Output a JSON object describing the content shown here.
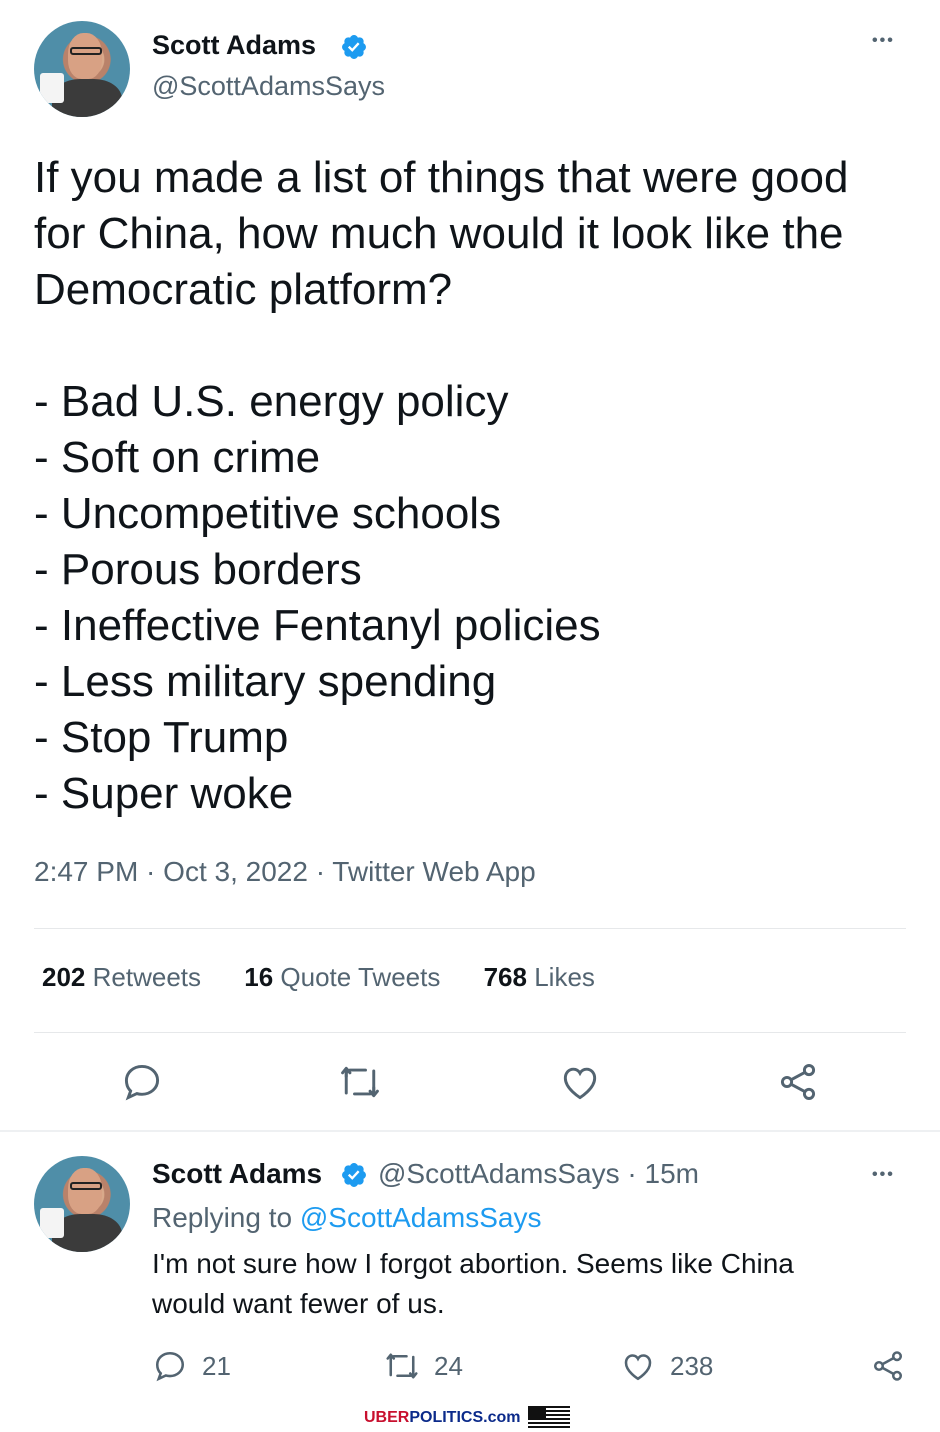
{
  "main_tweet": {
    "author_name": "Scott Adams",
    "author_handle": "@ScottAdamsSays",
    "more_label": "•••",
    "text_lines": [
      "If you made a list of things that were good",
      "for China, how much would it look like the",
      "Democratic platform?",
      "",
      "- Bad U.S. energy policy",
      "- Soft on crime",
      "- Uncompetitive schools",
      "- Porous borders",
      "- Ineffective Fentanyl policies",
      "- Less military spending",
      "- Stop Trump",
      "- Super woke"
    ],
    "timestamp": "2:47 PM · Oct 3, 2022 · Twitter Web App",
    "stats": {
      "retweets_count": "202",
      "retweets_label": "Retweets",
      "quote_count": "16",
      "quote_label": "Quote Tweets",
      "likes_count": "768",
      "likes_label": "Likes"
    },
    "actions": [
      "reply-icon",
      "retweet-icon",
      "like-icon",
      "share-icon"
    ]
  },
  "reply_tweet": {
    "author_name": "Scott Adams",
    "author_handle": "@ScottAdamsSays",
    "time_ago": "· 15m",
    "more_label": "•••",
    "replying_prefix": "Replying to",
    "replying_handle": "@ScottAdamsSays",
    "text": "I'm not sure how I forgot abortion. Seems like China would want fewer of us.",
    "reply_count": "21",
    "retweet_count": "24",
    "like_count": "238"
  },
  "footer": {
    "brand_uber": "UBER",
    "brand_politics": "POLITICS.com"
  },
  "colors": {
    "verified_blue": "#1d9bf0",
    "secondary_text": "#536471",
    "primary_text": "#0f1419"
  }
}
